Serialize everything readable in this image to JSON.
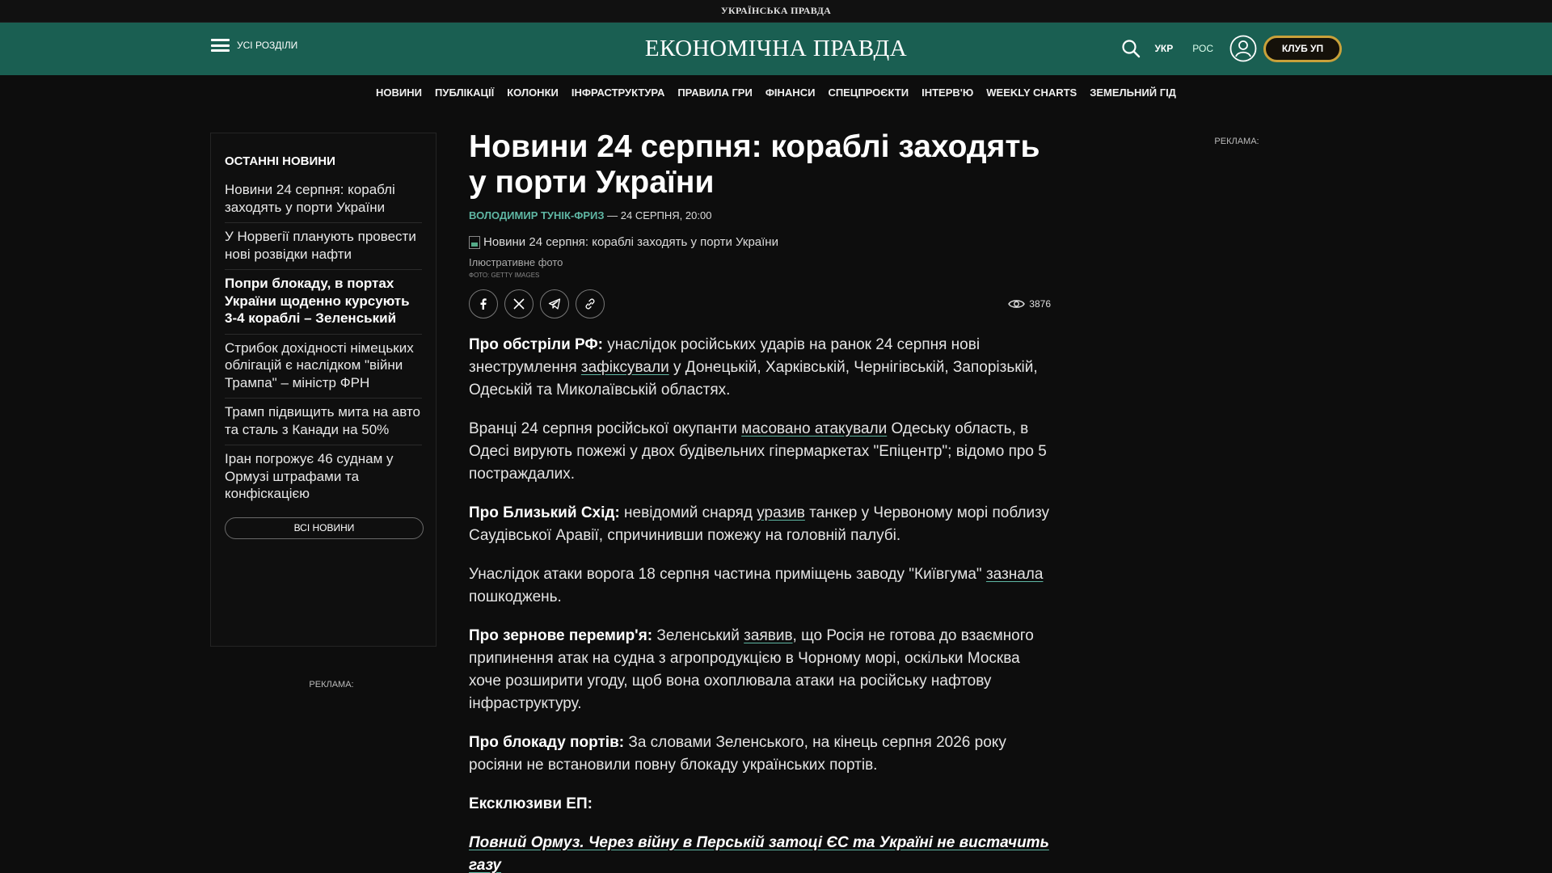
{
  "topbar": {
    "brand": "УКРАЇНСЬКА ПРАВДА"
  },
  "header": {
    "menu_label": "УСІ РОЗДІЛИ",
    "logo": "ЕКОНОМІЧНА ПРАВДА",
    "lang_ukr": "УКР",
    "lang_ros": "РОС",
    "club_button": "КЛУБ УП",
    "accent_color": "#1a5f52",
    "club_border_color": "#c9a13a"
  },
  "nav": {
    "items": [
      "НОВИНИ",
      "ПУБЛІКАЦІЇ",
      "КОЛОНКИ",
      "ІНФРАСТРУКТУРА",
      "ПРАВИЛА ГРИ",
      "ФІНАНСИ",
      "СПЕЦПРОЄКТИ",
      "ІНТЕРВ'Ю",
      "WEEKLY CHARTS",
      "ЗЕМЕЛЬНИЙ ГІД"
    ]
  },
  "sidebar": {
    "title": "ОСТАННІ НОВИНИ",
    "items": [
      {
        "label": "Новини 24 серпня: кораблі заходять у порти України",
        "bold": false
      },
      {
        "label": "У Норвегії планують провести нові розвідки нафти",
        "bold": false
      },
      {
        "label": "Попри блокаду, в портах України щоденно курсують 3-4 кораблі – Зеленський",
        "bold": true
      },
      {
        "label": "Стрибок дохідності німецьких облігацій є наслідком \"війни Трампа\" – міністр ФРН",
        "bold": false
      },
      {
        "label": "Трамп підвищить мита на авто та сталь з Канади на 50%",
        "bold": false
      },
      {
        "label": "Іран погрожує 46 суднам у Ормузі штрафами та конфіскацією",
        "bold": false
      }
    ],
    "all_news": "ВСІ НОВИНИ"
  },
  "ads": {
    "left": "РЕКЛАМА:",
    "right": "РЕКЛАМА:"
  },
  "article": {
    "title": "Новини 24 серпня: кораблі заходять у порти України",
    "author": "ВОЛОДИМИР ТУНІК-ФРИЗ",
    "date": " — 24 СЕРПНЯ, 20:00",
    "image_alt": "Новини 24 серпня: кораблі заходять у порти України",
    "caption": "Ілюстративне фото",
    "credit": "ФОТО: GETTY IMAGES",
    "views": "3876",
    "p1": {
      "lead": "Про обстріли РФ:",
      "t1": " унаслідок російських ударів на ранок 24 серпня нові знеструмлення ",
      "link": "зафіксували",
      "t2": " у Донецькій, Харківській, Чернігівській, Запорізькій, Одеській та Миколаївській областях."
    },
    "p2": {
      "t1": "Вранці 24 серпня російської окупанти ",
      "link": "масовано атакували",
      "t2": " Одеську область, в Одесі вирують пожежі у двох будівельних гіпермаркетах \"Епіцентр\"; відомо про 5 постраждалих."
    },
    "p3": {
      "lead": "Про Близький Схід:",
      "t1": " невідомий снаряд ",
      "link": "уразив",
      "t2": " танкер у Червоному морі поблизу Саудівської Аравії, спричинивши пожежу на головній палубі."
    },
    "p4": {
      "t1": "Унаслідок атаки ворога 18 серпня частина приміщень заводу \"Київгума\" ",
      "link": "зазнала",
      "t2": " пошкоджень."
    },
    "p5": {
      "lead": "Про зернове перемир'я:",
      "t1": " Зеленський ",
      "link": "заявив",
      "t2": ", що Росія не готова до взаємного припинення атак на судна з агропродукцією в Чорному морі, оскільки Москва хоче розширити угоду, щоб вона охоплювала атаки на російську нафтову інфраструктуру."
    },
    "p6": {
      "lead": "Про блокаду портів:",
      "t1": " За словами Зеленського, на кінець серпня 2026 року росіяни не встановили повну блокаду українських портів."
    },
    "exclusives_heading": "Ексклюзиви ЕП:",
    "exclusive_link": "Повний Ормуз. Через війну в Перській затоці ЄС та Україні не вистачить газу"
  }
}
